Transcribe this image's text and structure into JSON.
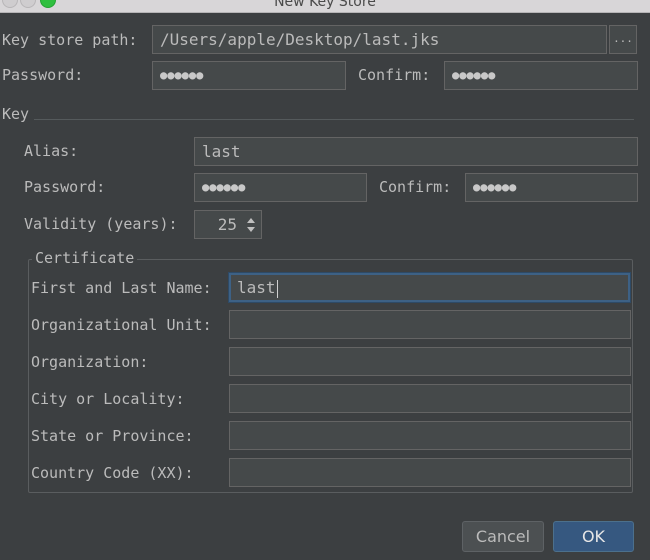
{
  "window": {
    "title": "New Key Store"
  },
  "keystore": {
    "path_label": "Key store path:",
    "path_value": "/Users/apple/Desktop/last.jks",
    "browse_label": "...",
    "password_label": "Password:",
    "password_mask": "●●●●●●",
    "confirm_label": "Confirm:",
    "confirm_mask": "●●●●●●"
  },
  "key": {
    "section_label": "Key",
    "alias_label": "Alias:",
    "alias_value": "last",
    "password_label": "Password:",
    "password_mask": "●●●●●●",
    "confirm_label": "Confirm:",
    "confirm_mask": "●●●●●●",
    "validity_label": "Validity (years):",
    "validity_value": "25"
  },
  "certificate": {
    "title": "Certificate",
    "fields": [
      {
        "label": "First and Last Name:",
        "value": "last"
      },
      {
        "label": "Organizational Unit:",
        "value": ""
      },
      {
        "label": "Organization:",
        "value": ""
      },
      {
        "label": "City or Locality:",
        "value": ""
      },
      {
        "label": "State or Province:",
        "value": ""
      },
      {
        "label": "Country Code (XX):",
        "value": ""
      }
    ]
  },
  "buttons": {
    "cancel": "Cancel",
    "ok": "OK"
  },
  "colors": {
    "background": "#3c3f41",
    "field_background": "#45494a",
    "focus_border": "#3d6185",
    "ok_button": "#365880",
    "maximize_button": "#2fbf3f"
  }
}
